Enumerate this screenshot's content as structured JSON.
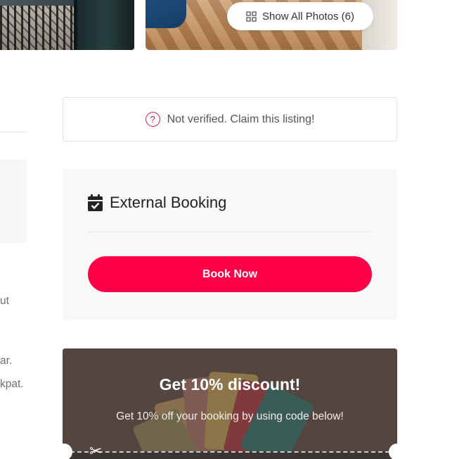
{
  "gallery": {
    "show_photos_label": "Show All Photos (6)",
    "show_photos_icon": "grid-icon"
  },
  "left_fragments": {
    "line1": "ut",
    "line2": "ar.",
    "line3": "kpat."
  },
  "claim": {
    "icon": "question-circle-icon",
    "label": "Not verified. Claim this listing!"
  },
  "booking": {
    "icon": "calendar-check-icon",
    "title": "External Booking",
    "button_label": "Book Now"
  },
  "discount": {
    "title": "Get 10% discount!",
    "subtitle": "Get 10% off your booking by using code below!",
    "icon": "scissors-icon"
  },
  "colors": {
    "accent": "#ff0048",
    "claim_icon": "#e8114a"
  }
}
